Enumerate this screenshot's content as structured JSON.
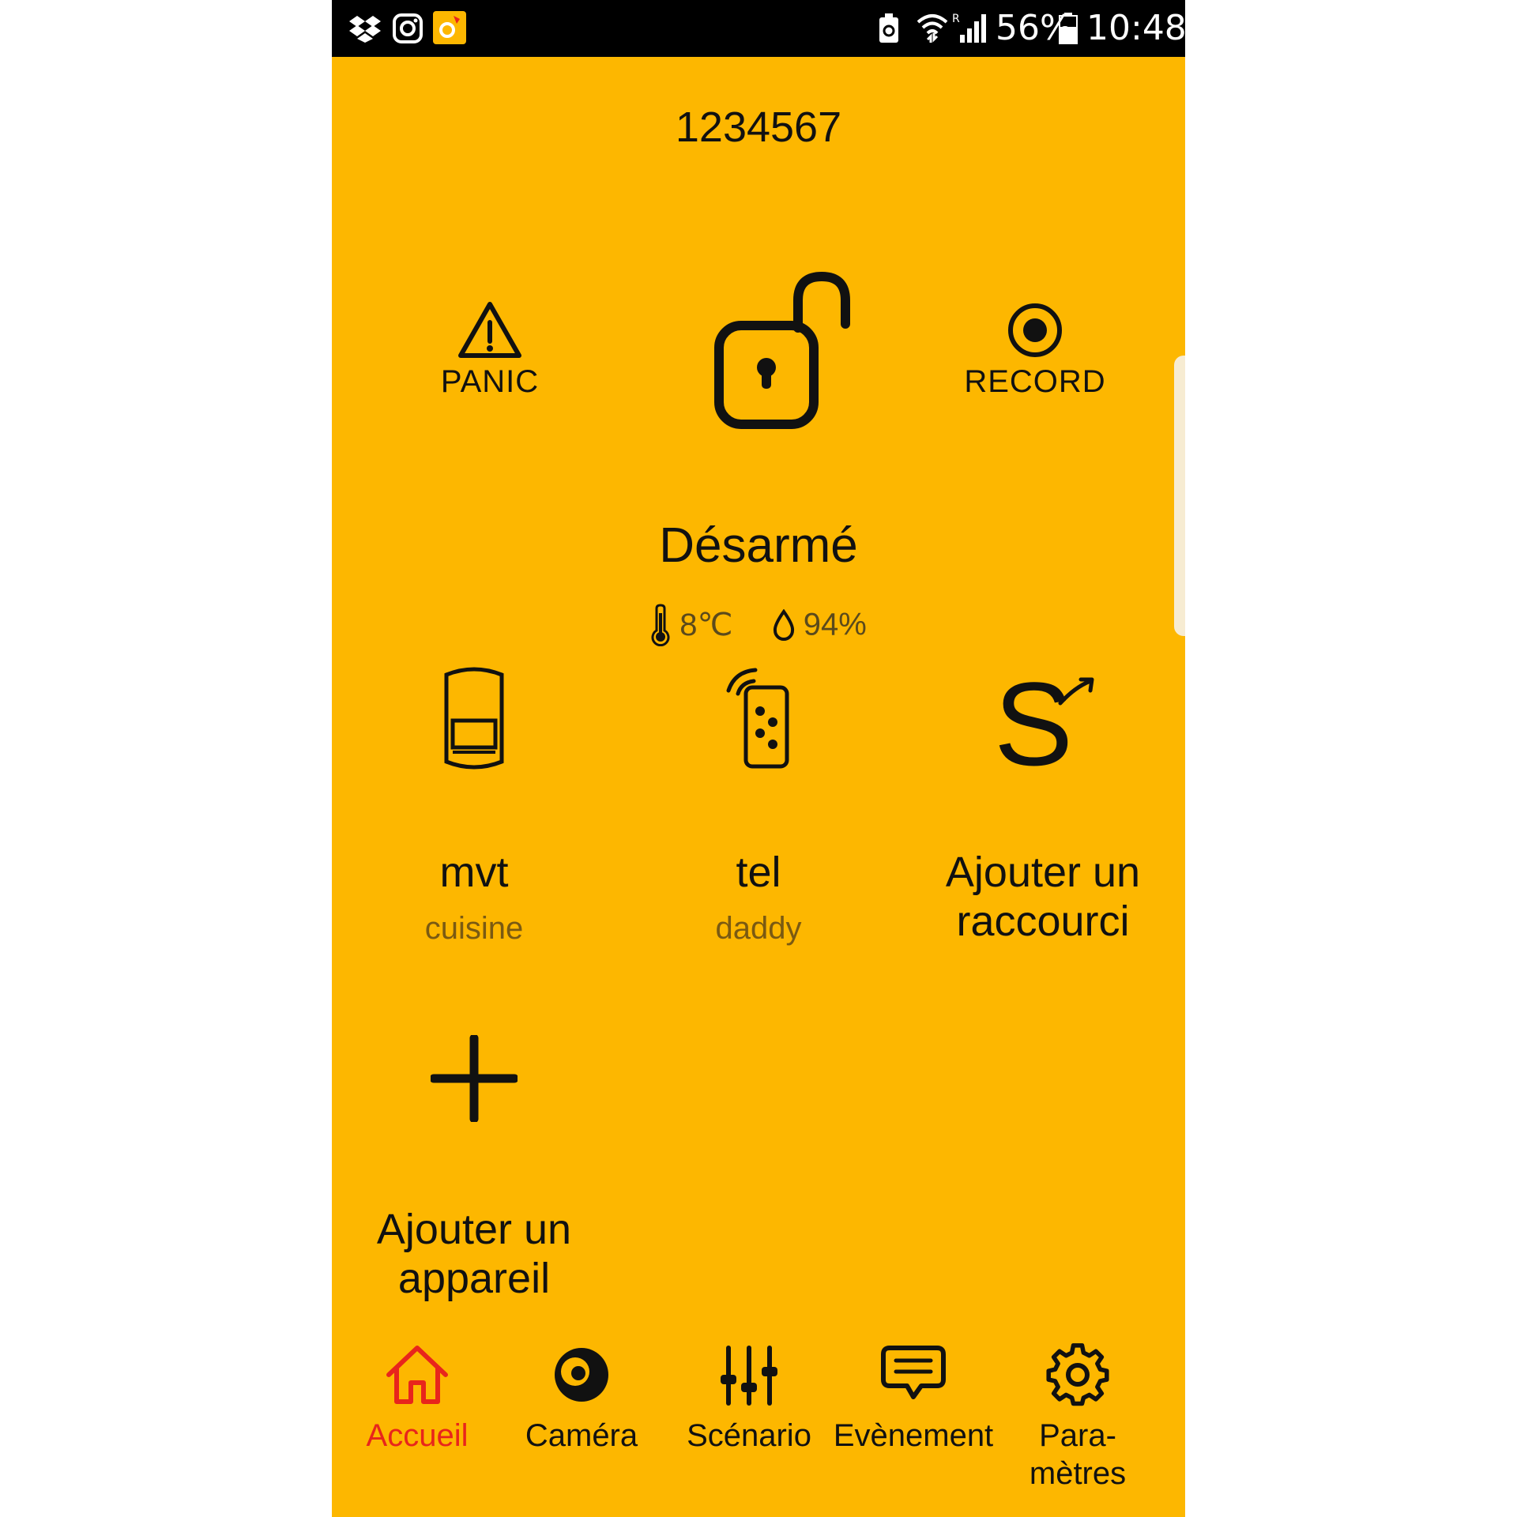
{
  "status_bar": {
    "battery_percent": "56%",
    "time": "10:48",
    "left_icons": [
      "dropbox-icon",
      "instagram-icon",
      "app-notification-icon"
    ],
    "right_icons": [
      "battery-saver-icon",
      "wifi-icon",
      "signal-icon",
      "battery-icon"
    ]
  },
  "header": {
    "account_number": "1234567"
  },
  "actions": {
    "panic_label": "PANIC",
    "record_label": "RECORD",
    "lock_icon": "unlocked-padlock-icon"
  },
  "alarm": {
    "status": "Désarmé",
    "temperature": "8℃",
    "humidity": "94%"
  },
  "tiles": [
    {
      "name": "mvt",
      "sub": "cuisine",
      "icon": "motion-sensor-icon"
    },
    {
      "name": "tel",
      "sub": "daddy",
      "icon": "remote-control-icon"
    },
    {
      "name": "Ajouter un raccourci",
      "icon": "add-shortcut-icon"
    },
    {
      "name": "Ajouter un appareil",
      "icon": "plus-icon"
    }
  ],
  "nav": {
    "items": [
      {
        "label": "Accueil",
        "icon": "home-icon",
        "active": true
      },
      {
        "label": "Caméra",
        "icon": "camera-icon"
      },
      {
        "label": "Scénario",
        "icon": "sliders-icon"
      },
      {
        "label": "Evènement",
        "icon": "message-icon"
      },
      {
        "label": "Para-\nmètres",
        "icon": "gear-icon"
      }
    ]
  },
  "colors": {
    "background": "#FDB700",
    "active": "#E8251C",
    "text": "#111111"
  }
}
